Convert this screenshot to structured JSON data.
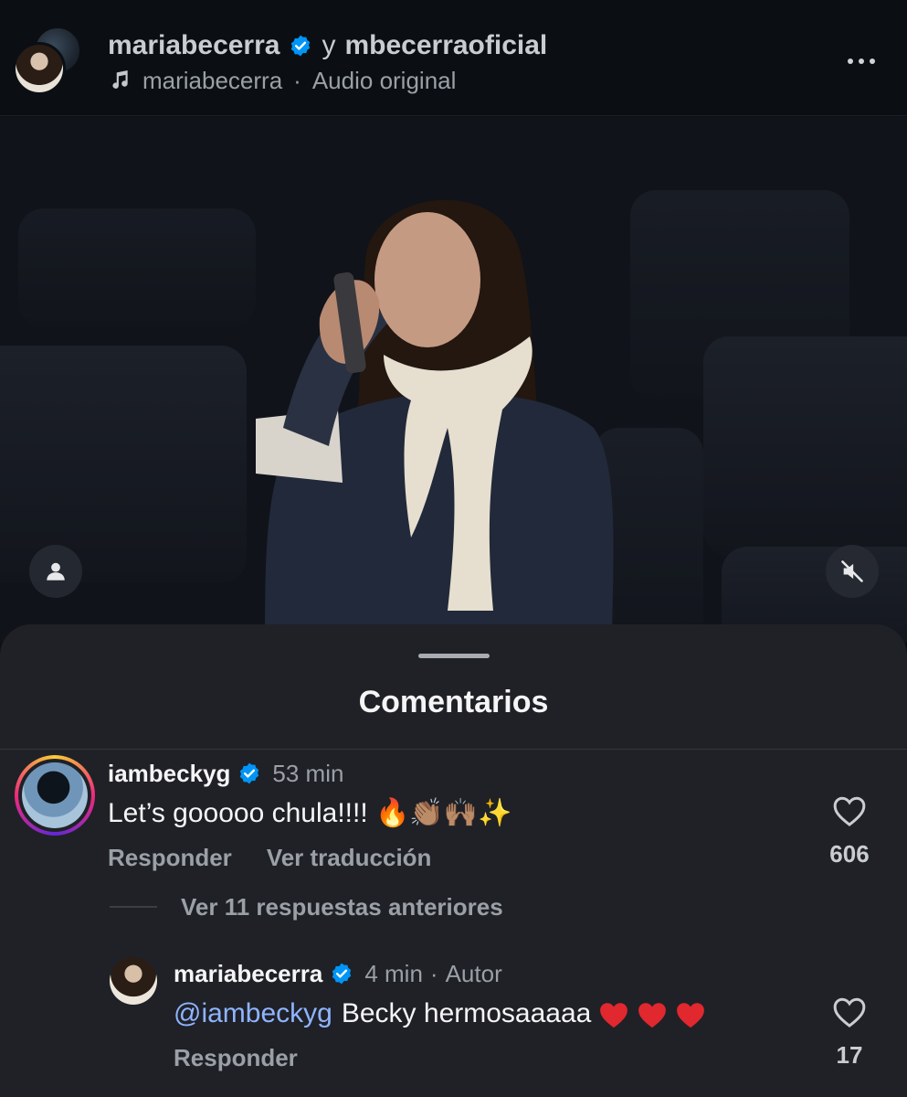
{
  "header": {
    "author": "mariabecerra",
    "joiner": "y",
    "coauthor": "mbecerraoficial",
    "audio_user": "mariabecerra",
    "audio_separator": "·",
    "audio_label": "Audio original"
  },
  "video": {
    "tag_icon": "person-tag-icon",
    "mute_icon": "speaker-muted-icon"
  },
  "comments_sheet": {
    "title": "Comentarios",
    "comment": {
      "username": "iambeckyg",
      "time": "53 min",
      "text": "Let’s gooooo chula!!!! 🔥👏🏽🙌🏽✨",
      "reply_label": "Responder",
      "translate_label": "Ver traducción",
      "likes": "606"
    },
    "replies_toggle": "Ver 11 respuestas anteriores",
    "reply": {
      "username": "mariabecerra",
      "time": "4 min",
      "separator": "·",
      "badge": "Autor",
      "mention": "@iambeckyg",
      "text": "Becky hermosaaaaa",
      "hearts": 3,
      "reply_label": "Responder",
      "likes": "17"
    }
  },
  "colors": {
    "verified": "#0095f6",
    "mention": "#8fb4ff",
    "heart": "#e0282e",
    "sheet": "#1f2127"
  }
}
